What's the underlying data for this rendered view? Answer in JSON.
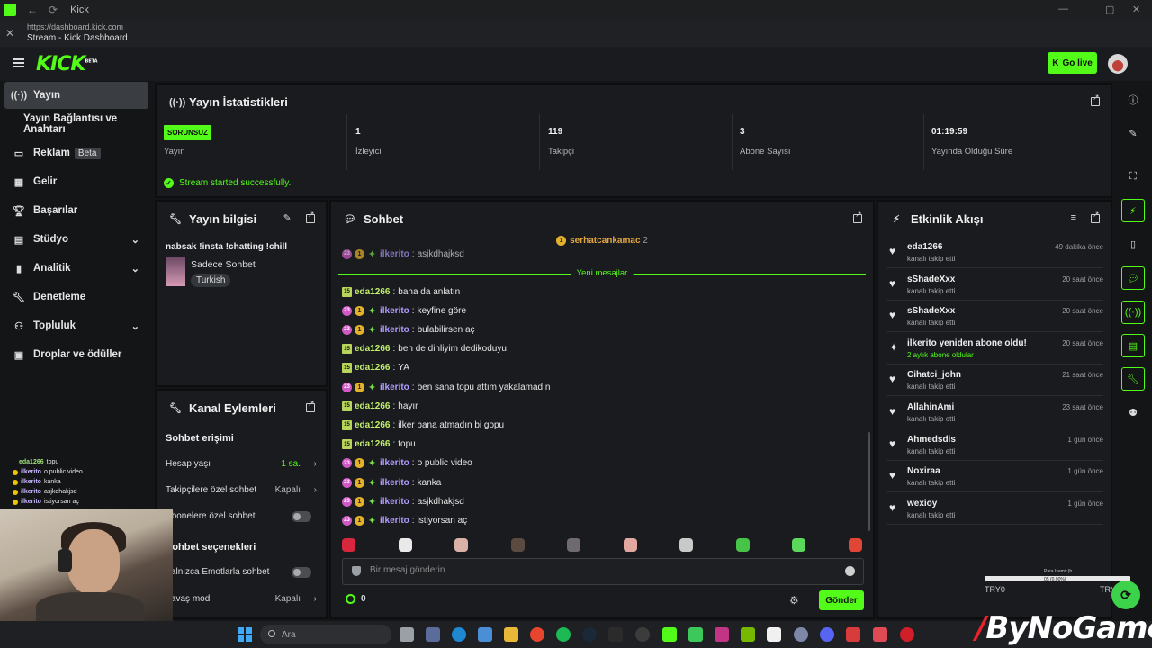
{
  "browser": {
    "tab_title": "Kick",
    "url": "https://dashboard.kick.com",
    "page_title": "Stream - Kick Dashboard"
  },
  "topbar": {
    "logo_text": "KICK",
    "logo_badge": "BETA",
    "go_live_label": "Go live"
  },
  "sidebar": {
    "items": [
      {
        "label": "Yayın",
        "icon": "broadcast-icon",
        "active": true
      },
      {
        "label": "Yayın Bağlantısı ve Anahtarı",
        "icon": "",
        "active": false
      },
      {
        "label": "Reklam",
        "badge": "Beta",
        "icon": "ad-icon"
      },
      {
        "label": "Gelir",
        "icon": "revenue-icon"
      },
      {
        "label": "Başarılar",
        "icon": "trophy-icon"
      },
      {
        "label": "Stüdyo",
        "icon": "studio-icon",
        "expandable": true
      },
      {
        "label": "Analitik",
        "icon": "analytics-icon",
        "expandable": true
      },
      {
        "label": "Denetleme",
        "icon": "wrench-icon"
      },
      {
        "label": "Topluluk",
        "icon": "community-icon",
        "expandable": true
      },
      {
        "label": "Droplar ve ödüller",
        "icon": "gift-icon"
      }
    ]
  },
  "mini_chat": [
    {
      "user": "eda1266",
      "text": "topu"
    },
    {
      "user": "ilkerito",
      "text": "o public video"
    },
    {
      "user": "ilkerito",
      "text": "kanka"
    },
    {
      "user": "ilkerito",
      "text": "asjkdhakjsd"
    },
    {
      "user": "ilkerito",
      "text": "istiyorsan aç"
    }
  ],
  "stats": {
    "title": "Yayın İstatistikleri",
    "status_badge": "SORUNSUZ",
    "status_label": "Yayın",
    "viewers_value": "1",
    "viewers_label": "İzleyici",
    "followers_value": "119",
    "followers_label": "Takipçi",
    "subs_value": "3",
    "subs_label": "Abone Sayısı",
    "uptime_value": "01:19:59",
    "uptime_label": "Yayında Olduğu Süre",
    "success_message": "Stream started successfully."
  },
  "stream_info": {
    "title": "Yayın bilgisi",
    "stream_title": "nabsak !insta !chatting !chill",
    "category": "Sadece Sohbet",
    "tag": "Turkish"
  },
  "channel_actions": {
    "title": "Kanal Eylemleri",
    "section_chat_access": "Sohbet erişimi",
    "account_age_label": "Hesap yaşı",
    "account_age_value": "1 sa.",
    "followers_only_label": "Takipçilere özel sohbet",
    "followers_only_value": "Kapalı",
    "subs_only_label": "Abonelere özel sohbet",
    "section_chat_options": "Sohbet seçenekleri",
    "emote_only_label": "Yalnızca Emotlarla sohbet",
    "slow_mode_label": "Yavaş mod",
    "slow_mode_value": "Kapalı"
  },
  "chat": {
    "title": "Sohbet",
    "pinned_user": "serhatcankamac",
    "pinned_count": "2",
    "cut_message": {
      "user": "ilkerito",
      "text": "asjkdhajksd"
    },
    "new_messages_label": "Yeni mesajlar",
    "messages": [
      {
        "user": "eda1266",
        "text": "bana da anlatın",
        "type": "eda"
      },
      {
        "user": "ilkerito",
        "text": "keyfine göre",
        "type": "ilk"
      },
      {
        "user": "ilkerito",
        "text": "bulabilirsen aç",
        "type": "ilk"
      },
      {
        "user": "eda1266",
        "text": "ben de dinliyim dedikoduyu",
        "type": "eda"
      },
      {
        "user": "eda1266",
        "text": "YA",
        "type": "eda"
      },
      {
        "user": "ilkerito",
        "text": "ben sana topu attım yakalamadın",
        "type": "ilk"
      },
      {
        "user": "eda1266",
        "text": "hayır",
        "type": "eda"
      },
      {
        "user": "eda1266",
        "text": "ilker bana atmadın bi gopu",
        "type": "eda"
      },
      {
        "user": "eda1266",
        "text": "topu",
        "type": "eda"
      },
      {
        "user": "ilkerito",
        "text": "o public video",
        "type": "ilk"
      },
      {
        "user": "ilkerito",
        "text": "kanka",
        "type": "ilk"
      },
      {
        "user": "ilkerito",
        "text": "asjkdhakjsd",
        "type": "ilk"
      },
      {
        "user": "ilkerito",
        "text": "istiyorsan aç",
        "type": "ilk"
      }
    ],
    "badge_sub_months": "15",
    "badge_sub_months_alt": "23",
    "badge_gold": "1",
    "input_placeholder": "Bir mesaj gönderin",
    "points": "0",
    "send_label": "Gönder"
  },
  "activity": {
    "title": "Etkinlik Akışı",
    "items": [
      {
        "name": "eda1266",
        "sub": "kanalı takip etti",
        "time": "49 dakika önce",
        "icon": "heart"
      },
      {
        "name": "sShadeXxx",
        "sub": "kanalı takip etti",
        "time": "20 saat önce",
        "icon": "heart"
      },
      {
        "name": "sShadeXxx",
        "sub": "kanalı takip etti",
        "time": "20 saat önce",
        "icon": "heart"
      },
      {
        "name": "ilkerito yeniden abone oldu!",
        "sub": "2 aylık abone oldular",
        "time": "20 saat önce",
        "icon": "sparkle"
      },
      {
        "name": "Cihatci_john",
        "sub": "kanalı takip etti",
        "time": "21 saat önce",
        "icon": "heart"
      },
      {
        "name": "AllahinAmi",
        "sub": "kanalı takip etti",
        "time": "23 saat önce",
        "icon": "heart"
      },
      {
        "name": "Ahmedsdis",
        "sub": "kanalı takip etti",
        "time": "1 gün önce",
        "icon": "heart"
      },
      {
        "name": "Noxiraa",
        "sub": "kanalı takip etti",
        "time": "1 gün önce",
        "icon": "heart"
      },
      {
        "name": "wexioy",
        "sub": "kanalı takip etti",
        "time": "1 gün önce",
        "icon": "heart"
      }
    ]
  },
  "overlay": {
    "goal_label": "Para Isami :(b",
    "goal_value": "0$ (0.00%)",
    "goal_progress": 0,
    "try_left": "TRY0",
    "try_right": "TRY1",
    "watermark_brand": "ByNoGame"
  },
  "taskbar": {
    "search_placeholder": "Ara"
  },
  "colors": {
    "accent": "#53fc18",
    "panel": "#191b1f",
    "background": "#141517"
  }
}
